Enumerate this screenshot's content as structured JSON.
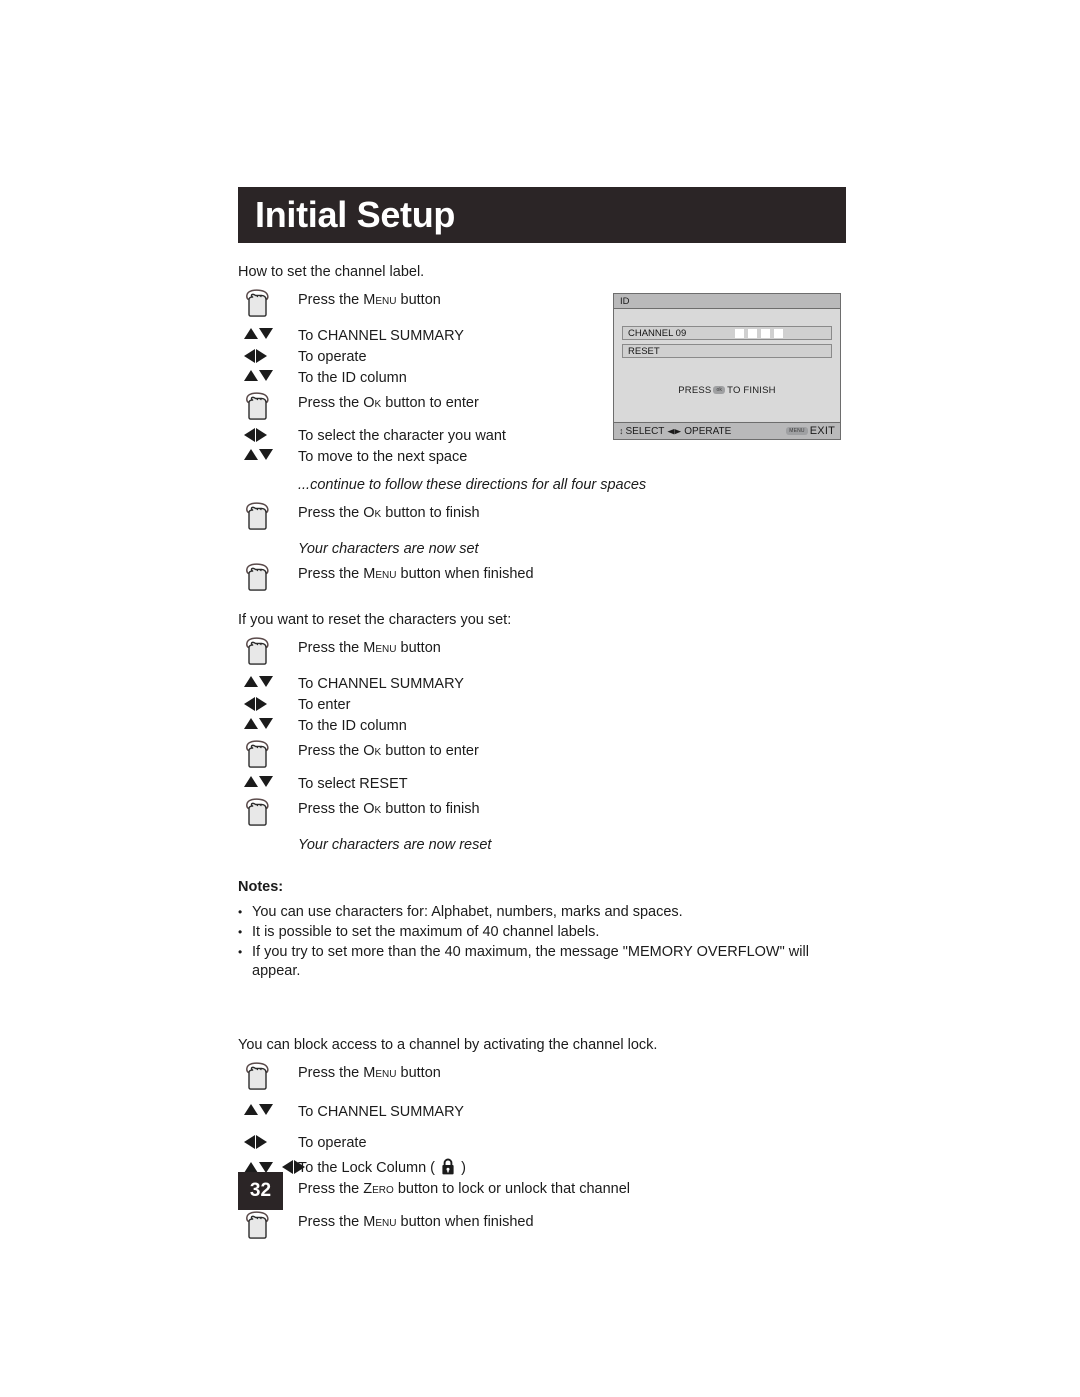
{
  "header": {
    "title": "Initial Setup"
  },
  "intro": {
    "channel_label": "How to set the channel label.",
    "reset_intro": "If you want to reset the characters you set:",
    "lock_intro": "You can block access to a channel by activating the channel lock."
  },
  "set_steps": [
    {
      "icon": "hand-press-icon",
      "text": "Press the MENU button",
      "style": "normal",
      "gap": "t0"
    },
    {
      "icon": "up-down-arrows-icon",
      "text": "To CHANNEL SUMMARY",
      "style": "normal",
      "gap": "t7"
    },
    {
      "icon": "left-right-arrows-icon",
      "text": "To operate",
      "style": "normal",
      "gap": "t0"
    },
    {
      "icon": "up-down-arrows-icon",
      "text": "To the ID column",
      "style": "normal",
      "gap": "t0"
    },
    {
      "icon": "hand-press-icon",
      "text": "Press the OK button to enter",
      "style": "normal",
      "gap": "t4"
    },
    {
      "icon": "left-right-arrows-icon",
      "text": "To select the character you want",
      "style": "normal",
      "gap": "t4"
    },
    {
      "icon": "up-down-arrows-icon",
      "text": "To move to the next space",
      "style": "normal",
      "gap": "t0"
    },
    {
      "icon": "none",
      "text": "...continue to follow these directions for all four spaces",
      "style": "italic",
      "gap": "t7"
    },
    {
      "icon": "hand-press-icon",
      "text": "Press the OK button to finish",
      "style": "normal",
      "gap": "t7"
    },
    {
      "icon": "none",
      "text": "Your characters are now set",
      "style": "italic",
      "gap": "t7"
    },
    {
      "icon": "hand-press-icon",
      "text": "Press the MENU button when finished",
      "style": "normal",
      "gap": "t4"
    }
  ],
  "reset_steps": [
    {
      "icon": "hand-press-icon",
      "text": "Press the MENU button",
      "style": "normal",
      "gap": "t7"
    },
    {
      "icon": "up-down-arrows-icon",
      "text": "To CHANNEL SUMMARY",
      "style": "normal",
      "gap": "t7"
    },
    {
      "icon": "left-right-arrows-icon",
      "text": "To enter",
      "style": "normal",
      "gap": "t0"
    },
    {
      "icon": "up-down-arrows-icon",
      "text": "To the ID column",
      "style": "normal",
      "gap": "t0"
    },
    {
      "icon": "hand-press-icon",
      "text": "Press the OK button to enter",
      "style": "normal",
      "gap": "t4"
    },
    {
      "icon": "up-down-arrows-icon",
      "text": "To select RESET",
      "style": "normal",
      "gap": "t4"
    },
    {
      "icon": "hand-press-icon",
      "text": "Press the OK button to finish",
      "style": "normal",
      "gap": "t4"
    },
    {
      "icon": "none",
      "text": "Your characters are now reset",
      "style": "italic",
      "gap": "t7"
    }
  ],
  "lock_steps": [
    {
      "icon": "hand-press-icon",
      "text": "Press the MENU button",
      "style": "normal",
      "gap": "t7"
    },
    {
      "icon": "up-down-arrows-icon",
      "text": "To CHANNEL SUMMARY",
      "style": "normal",
      "gap": "t10"
    },
    {
      "icon": "left-right-arrows-icon",
      "text": "To operate",
      "style": "normal",
      "gap": "t10"
    },
    {
      "icon": "up-down-left-right-arrows-icon",
      "text": "To the Lock Column ( LOCKGLYPH )",
      "style": "normal",
      "gap": "t4"
    },
    {
      "icon": "hand-press-icon",
      "text": "Press the ZERO button to lock or unlock that channel",
      "style": "normal",
      "gap": "t0"
    },
    {
      "icon": "hand-press-icon",
      "text": "Press the MENU button when finished",
      "style": "normal",
      "gap": "t4"
    }
  ],
  "notes": {
    "title": "Notes:",
    "bullet": "•",
    "items": [
      "You can use characters for: Alphabet, numbers, marks and spaces.",
      "It is possible to set the maximum of 40 channel labels.",
      "If you try to set more than the 40 maximum, the message \"MEMORY OVERFLOW\" will appear."
    ]
  },
  "osd": {
    "header_label": "ID",
    "rows": [
      {
        "label": "CHANNEL 09",
        "boxes": 4
      },
      {
        "label": "RESET",
        "boxes": 0
      }
    ],
    "finish_prefix": "PRESS",
    "finish_badge": "ok",
    "finish_suffix": "TO FINISH",
    "footer": {
      "updown_glyph": "↕",
      "select_label": "SELECT",
      "leftright_glyph": "◀▶",
      "operate_label": "OPERATE",
      "menu_badge": "MENU",
      "exit_label": "EXIT"
    }
  },
  "footer": {
    "page_number": "32"
  },
  "colors": {
    "banner": "#2b2526",
    "text": "#1b1b1b",
    "osd_header": "#b9b9ba",
    "osd_body": "#d9d9d9",
    "osd_row": "#d0d0d0",
    "osd_border": "#6d6d6d"
  }
}
